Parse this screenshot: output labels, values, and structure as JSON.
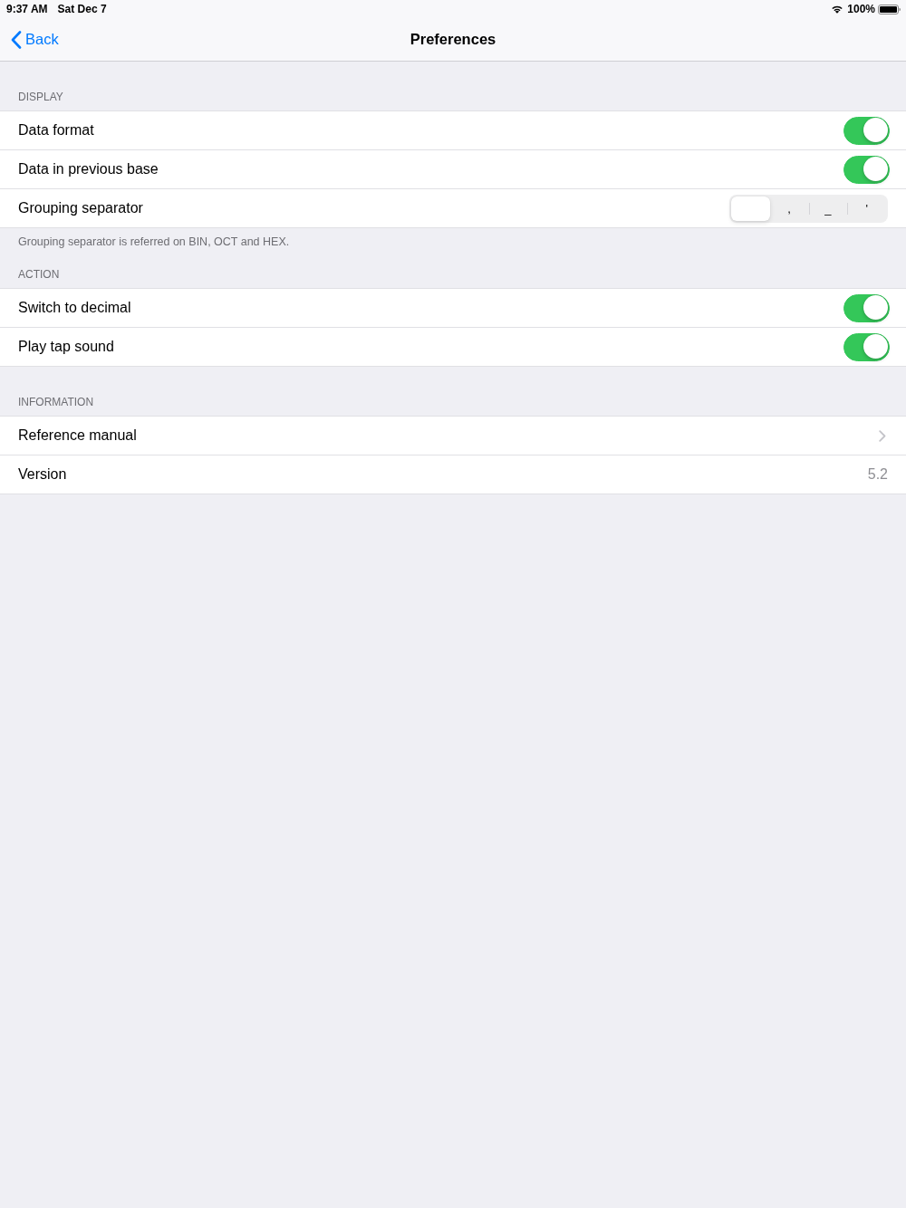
{
  "status_bar": {
    "time": "9:37 AM",
    "date": "Sat Dec 7",
    "battery_text": "100%"
  },
  "nav": {
    "back": "Back",
    "title": "Preferences"
  },
  "sections": [
    {
      "header": "DISPLAY",
      "footer": "Grouping separator is referred on BIN, OCT and HEX.",
      "rows": [
        {
          "kind": "toggle",
          "label": "Data format",
          "on": true
        },
        {
          "kind": "toggle",
          "label": "Data in previous base",
          "on": true
        },
        {
          "kind": "segmented",
          "label": "Grouping separator",
          "segments": [
            {
              "selected": true
            },
            {
              "label": ",",
              "selected": false
            },
            {
              "label": "_",
              "selected": false
            },
            {
              "label": "'",
              "selected": false
            }
          ]
        }
      ]
    },
    {
      "header": "ACTION",
      "rows": [
        {
          "kind": "toggle",
          "label": "Switch to decimal",
          "on": true
        },
        {
          "kind": "toggle",
          "label": "Play tap sound",
          "on": true
        }
      ]
    },
    {
      "header": "INFORMATION",
      "rows": [
        {
          "kind": "link",
          "label": "Reference manual"
        },
        {
          "kind": "value",
          "label": "Version",
          "value": "5.2"
        }
      ]
    }
  ]
}
